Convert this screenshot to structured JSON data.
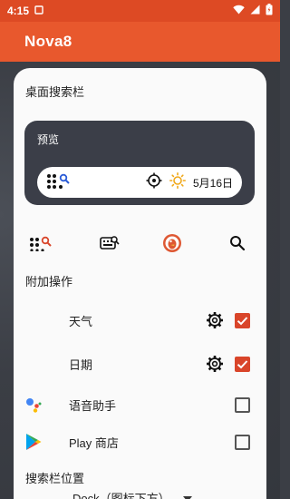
{
  "status": {
    "time": "4:15"
  },
  "app": {
    "title": "Nova8"
  },
  "search_bar": {
    "section_title": "桌面搜索栏",
    "preview_label": "预览",
    "date_text": "5月16日"
  },
  "additional_actions": {
    "section_title": "附加操作",
    "items": [
      {
        "label": "天气",
        "has_settings": true,
        "checked": true
      },
      {
        "label": "日期",
        "has_settings": true,
        "checked": true
      },
      {
        "label": "语音助手",
        "has_settings": false,
        "checked": false
      },
      {
        "label": "Play 商店",
        "has_settings": false,
        "checked": false
      }
    ]
  },
  "position": {
    "section_title": "搜索栏位置",
    "selected": "Dock（图标下方）"
  },
  "colors": {
    "accent": "#e8582d",
    "status_bar": "#dd4a24",
    "checkbox_on": "#d9452a",
    "preview_bg": "#3b3e48"
  }
}
